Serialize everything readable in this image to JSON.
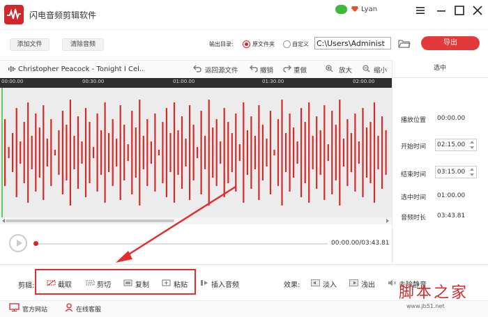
{
  "app": {
    "title": "闪电音频剪辑软件",
    "username": "Lyan"
  },
  "toolbar": {
    "add_file": "添加文件",
    "remove_audio": "清除音频",
    "output_dir_label": "输出目录:",
    "radio_source": "原文件夹",
    "radio_custom": "自定义",
    "path_value": "C:\\Users\\Administ",
    "export": "导出"
  },
  "wave_header": {
    "track_name": "Christopher Peacock - Tonight I Cel...",
    "back_to_source": "返回源文件",
    "undo": "撤销",
    "redo": "重做",
    "zoom_in": "放大",
    "zoom_out": "缩小"
  },
  "timeline": {
    "ticks": [
      "00:00.00",
      "00:30.00",
      "01:00.00",
      "01:30.00",
      "02:00.00"
    ]
  },
  "right_panel": {
    "tab": "选中",
    "play_position_label": "播放位置",
    "play_position_value": "00:00.00",
    "start_time_label": "开始时间",
    "start_time_value": "02:15.00",
    "end_time_label": "结束时间",
    "end_time_value": "03:15.00",
    "selected_time_label": "选中时间",
    "selected_time_value": "01:00.00",
    "duration_label": "音频时长",
    "duration_value": "03:43.81"
  },
  "player": {
    "time": "00:00.00/03:43.81",
    "progress": 0.0
  },
  "bottom_toolbar": {
    "edit_label": "剪辑:",
    "trim": "截取",
    "cut": "剪切",
    "copy": "复制",
    "paste": "粘贴",
    "insert_audio": "插入音频",
    "effects_label": "效果:",
    "fade_in": "淡入",
    "fade_out": "浅出",
    "remove_silence": "去除静音"
  },
  "footer": {
    "official_site": "官方网站",
    "online_service": "在线客服"
  },
  "watermark": {
    "main": "脚本之家",
    "sub": "www.jb51.net"
  },
  "colors": {
    "accent": "#d3262c",
    "waveform": "#d42a2a",
    "highlight": "#e52d2d",
    "playhead": "#5ccf5c"
  },
  "waveform_amplitudes": [
    0.6,
    0.1,
    0.35,
    0.8,
    0.2,
    0.55,
    0.9,
    0.3,
    0.7,
    0.45,
    0.85,
    0.25,
    0.6,
    0.05,
    0.4,
    0.75,
    0.5,
    0.95,
    0.3,
    0.65,
    0.2,
    0.8,
    0.55,
    0.1,
    0.7,
    0.4,
    0.9,
    0.35,
    0.6,
    0.25,
    0.85,
    0.5,
    0.15,
    0.75,
    0.45,
    0.95,
    0.3,
    0.6,
    0.2,
    0.7,
    0.05,
    0.55,
    0.8,
    0.35,
    0.9,
    0.4,
    0.65,
    0.25,
    0.85,
    0.5,
    0.1,
    0.75,
    0.3,
    0.95,
    0.45,
    0.6,
    0.2,
    0.8,
    0.55,
    0.35,
    0.7,
    0.15,
    0.9,
    0.4,
    0.65,
    0.3,
    0.85,
    0.5,
    0.25,
    0.75,
    0.05,
    0.6,
    0.95,
    0.35,
    0.7,
    0.45,
    0.2,
    0.8,
    0.55,
    0.9,
    0.3,
    0.65,
    0.4,
    0.85,
    0.15,
    0.75,
    0.5,
    0.95,
    0.25,
    0.6,
    0.35,
    0.7,
    0.2,
    0.8,
    0.45,
    0.55,
    0.9,
    0.3,
    0.65,
    0.4
  ]
}
